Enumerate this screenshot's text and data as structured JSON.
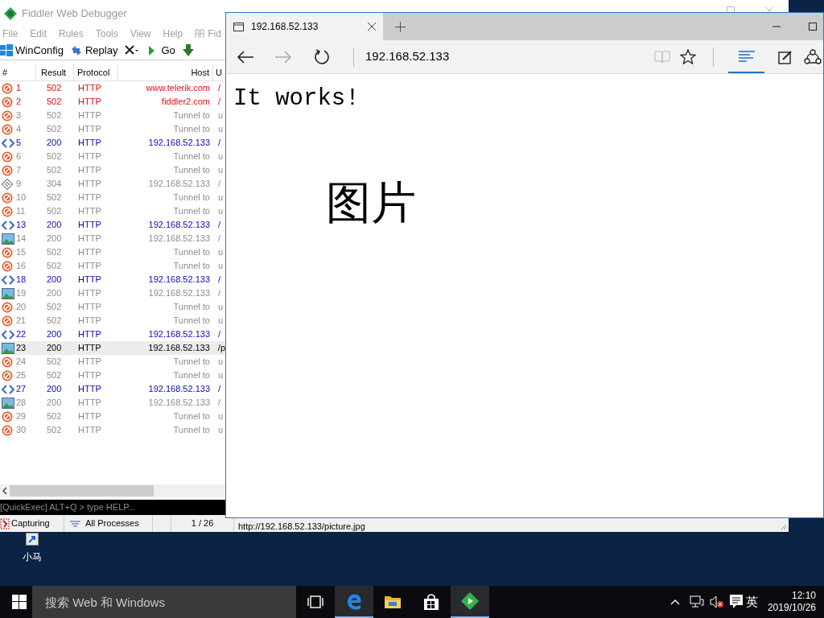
{
  "desktop": {
    "icons": [
      {
        "label": "小马"
      }
    ]
  },
  "fiddler": {
    "title": "Fiddler Web Debugger",
    "menu": [
      "File",
      "Edit",
      "Rules",
      "Tools",
      "View",
      "Help",
      "Fid"
    ],
    "toolbar": [
      {
        "kind": "winconfig",
        "label": "WinConfig"
      },
      {
        "kind": "replay",
        "label": "Replay"
      },
      {
        "kind": "remove"
      },
      {
        "kind": "go",
        "label": "Go"
      },
      {
        "kind": "stream"
      }
    ],
    "columns": [
      "#",
      "Result",
      "Protocol",
      "Host",
      "U"
    ],
    "rows": [
      {
        "id": "1",
        "result": "502",
        "protocol": "HTTP",
        "host": "www.telerik.com",
        "url": "/",
        "kind": "blocked",
        "color": "#e01010",
        "selected": false
      },
      {
        "id": "2",
        "result": "502",
        "protocol": "HTTP",
        "host": "fiddler2.com",
        "url": "/",
        "kind": "blocked",
        "color": "#e01010",
        "selected": false
      },
      {
        "id": "3",
        "result": "502",
        "protocol": "HTTP",
        "host": "Tunnel to",
        "url": "u",
        "kind": "blocked",
        "color": "#8c8c8c",
        "selected": false
      },
      {
        "id": "4",
        "result": "502",
        "protocol": "HTTP",
        "host": "Tunnel to",
        "url": "u",
        "kind": "blocked",
        "color": "#8c8c8c",
        "selected": false
      },
      {
        "id": "5",
        "result": "200",
        "protocol": "HTTP",
        "host": "192.168.52.133",
        "url": "/",
        "kind": "html",
        "color": "#0a0ab4",
        "selected": false
      },
      {
        "id": "6",
        "result": "502",
        "protocol": "HTTP",
        "host": "Tunnel to",
        "url": "u",
        "kind": "blocked",
        "color": "#8c8c8c",
        "selected": false
      },
      {
        "id": "7",
        "result": "502",
        "protocol": "HTTP",
        "host": "Tunnel to",
        "url": "u",
        "kind": "blocked",
        "color": "#8c8c8c",
        "selected": false
      },
      {
        "id": "9",
        "result": "304",
        "protocol": "HTTP",
        "host": "192.168.52.133",
        "url": "/",
        "kind": "cached",
        "color": "#8c8c8c",
        "selected": false
      },
      {
        "id": "10",
        "result": "502",
        "protocol": "HTTP",
        "host": "Tunnel to",
        "url": "u",
        "kind": "blocked",
        "color": "#8c8c8c",
        "selected": false
      },
      {
        "id": "11",
        "result": "502",
        "protocol": "HTTP",
        "host": "Tunnel to",
        "url": "u",
        "kind": "blocked",
        "color": "#8c8c8c",
        "selected": false
      },
      {
        "id": "13",
        "result": "200",
        "protocol": "HTTP",
        "host": "192.168.52.133",
        "url": "/",
        "kind": "html",
        "color": "#0a0ab4",
        "selected": false
      },
      {
        "id": "14",
        "result": "200",
        "protocol": "HTTP",
        "host": "192.168.52.133",
        "url": "/",
        "kind": "image",
        "color": "#8c8c8c",
        "selected": false
      },
      {
        "id": "15",
        "result": "502",
        "protocol": "HTTP",
        "host": "Tunnel to",
        "url": "u",
        "kind": "blocked",
        "color": "#8c8c8c",
        "selected": false
      },
      {
        "id": "16",
        "result": "502",
        "protocol": "HTTP",
        "host": "Tunnel to",
        "url": "u",
        "kind": "blocked",
        "color": "#8c8c8c",
        "selected": false
      },
      {
        "id": "18",
        "result": "200",
        "protocol": "HTTP",
        "host": "192.168.52.133",
        "url": "/",
        "kind": "html",
        "color": "#0a0ab4",
        "selected": false
      },
      {
        "id": "19",
        "result": "200",
        "protocol": "HTTP",
        "host": "192.168.52.133",
        "url": "/",
        "kind": "image",
        "color": "#8c8c8c",
        "selected": false
      },
      {
        "id": "20",
        "result": "502",
        "protocol": "HTTP",
        "host": "Tunnel to",
        "url": "u",
        "kind": "blocked",
        "color": "#8c8c8c",
        "selected": false
      },
      {
        "id": "21",
        "result": "502",
        "protocol": "HTTP",
        "host": "Tunnel to",
        "url": "u",
        "kind": "blocked",
        "color": "#8c8c8c",
        "selected": false
      },
      {
        "id": "22",
        "result": "200",
        "protocol": "HTTP",
        "host": "192.168.52.133",
        "url": "/",
        "kind": "html",
        "color": "#0a0ab4",
        "selected": false
      },
      {
        "id": "23",
        "result": "200",
        "protocol": "HTTP",
        "host": "192.168.52.133",
        "url": "/p",
        "kind": "image",
        "color": "#000000",
        "selected": true
      },
      {
        "id": "24",
        "result": "502",
        "protocol": "HTTP",
        "host": "Tunnel to",
        "url": "u",
        "kind": "blocked",
        "color": "#8c8c8c",
        "selected": false
      },
      {
        "id": "25",
        "result": "502",
        "protocol": "HTTP",
        "host": "Tunnel to",
        "url": "u",
        "kind": "blocked",
        "color": "#8c8c8c",
        "selected": false
      },
      {
        "id": "27",
        "result": "200",
        "protocol": "HTTP",
        "host": "192.168.52.133",
        "url": "/",
        "kind": "html",
        "color": "#0a0ab4",
        "selected": false
      },
      {
        "id": "28",
        "result": "200",
        "protocol": "HTTP",
        "host": "192.168.52.133",
        "url": "/",
        "kind": "image",
        "color": "#8c8c8c",
        "selected": false
      },
      {
        "id": "29",
        "result": "502",
        "protocol": "HTTP",
        "host": "Tunnel to",
        "url": "u",
        "kind": "blocked",
        "color": "#8c8c8c",
        "selected": false
      },
      {
        "id": "30",
        "result": "502",
        "protocol": "HTTP",
        "host": "Tunnel to",
        "url": "u",
        "kind": "blocked",
        "color": "#8c8c8c",
        "selected": false
      }
    ],
    "quickexec": {
      "placeholder": "[QuickExec] ALT+Q > type HELP..."
    },
    "status_bar": {
      "capturing": "Capturing",
      "processes": "All Processes",
      "count": "1 / 26",
      "url": "http://192.168.52.133/picture.jpg"
    }
  },
  "browser": {
    "tab": {
      "title": "192.168.52.133"
    },
    "address": "192.168.52.133",
    "heading": "It works!",
    "image_alt": "图片"
  },
  "taskbar": {
    "search": {
      "placeholder": "搜索 Web 和 Windows"
    },
    "apps": [
      {
        "kind": "taskview",
        "selected": false
      },
      {
        "kind": "edge",
        "selected": true
      },
      {
        "kind": "explorer",
        "selected": false
      },
      {
        "kind": "store",
        "selected": false
      },
      {
        "kind": "fiddler",
        "selected": true
      }
    ],
    "ime": "英",
    "time": "12:10",
    "date": "2019/10/26"
  }
}
